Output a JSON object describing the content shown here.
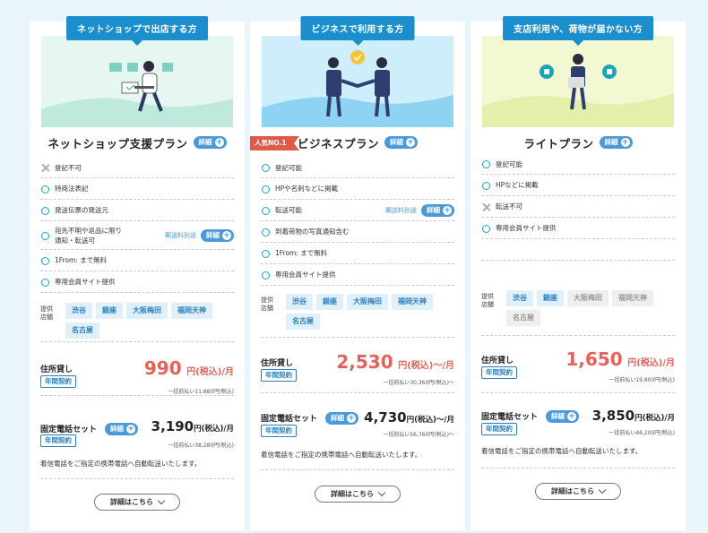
{
  "colors": {
    "accent": "#1b8fce",
    "price": "#e8605a",
    "check": "#1aa6b7",
    "page_bg": "#eaf4fb"
  },
  "cards": [
    {
      "tab": "ネットショップで出店する方",
      "title": "ネットショップ支援プラン",
      "detail_label": "詳細",
      "features": [
        {
          "ok": false,
          "text": "登記不可"
        },
        {
          "ok": true,
          "text": "特商法表記"
        },
        {
          "ok": true,
          "text": "発送伝票の発送元"
        },
        {
          "ok": true,
          "text": "宛先不明や返品に限り\n通知・転送可",
          "note": "郵送料別途",
          "detail": "詳細"
        },
        {
          "ok": true,
          "text": "1From: まで無料"
        },
        {
          "ok": true,
          "text": "専用会員サイト提供"
        }
      ],
      "stores_label": "提供\n店舗",
      "stores": [
        {
          "name": "渋谷",
          "available": true
        },
        {
          "name": "銀座",
          "available": true
        },
        {
          "name": "大阪梅田",
          "available": true
        },
        {
          "name": "福岡天神",
          "available": true
        },
        {
          "name": "名古屋",
          "available": true
        }
      ],
      "address_label": "住所貸し",
      "contract": "年間契約",
      "price": "990",
      "price_unit": "円(税込)/月",
      "lump_sum": "一括前払い11,880円(税込)",
      "tel_label": "固定電話セット",
      "tel_detail": "詳細",
      "tel_contract": "年間契約",
      "tel_price": "3,190",
      "tel_unit": "円(税込)/月",
      "tel_lump_sum": "一括前払い38,280円(税込)",
      "forward_note": "着信電話をご指定の携帯電話へ自動転送いたします。",
      "more": "詳細はこちら"
    },
    {
      "tab": "ビジネスで利用する方",
      "ribbon": "人気NO.1",
      "title": "ビジネスプラン",
      "detail_label": "詳細",
      "features": [
        {
          "ok": true,
          "text": "登記可能"
        },
        {
          "ok": true,
          "text": "HPや名刺などに掲載"
        },
        {
          "ok": true,
          "text": "転送可能",
          "note": "郵送料別途",
          "detail": "詳細"
        },
        {
          "ok": true,
          "text": "到着荷物の写真通知含む"
        },
        {
          "ok": true,
          "text": "1From: まで無料"
        },
        {
          "ok": true,
          "text": "専用会員サイト提供"
        }
      ],
      "stores_label": "提供\n店舗",
      "stores": [
        {
          "name": "渋谷",
          "available": true
        },
        {
          "name": "銀座",
          "available": true
        },
        {
          "name": "大阪梅田",
          "available": true
        },
        {
          "name": "福岡天神",
          "available": true
        },
        {
          "name": "名古屋",
          "available": true
        }
      ],
      "address_label": "住所貸し",
      "contract": "年間契約",
      "price": "2,530",
      "price_unit": "円(税込)～/月",
      "lump_sum": "一括前払い30,360円(税込)～",
      "tel_label": "固定電話セット",
      "tel_detail": "詳細",
      "tel_contract": "年間契約",
      "tel_price": "4,730",
      "tel_unit": "円(税込)～/月",
      "tel_lump_sum": "一括前払い56,760円(税込)～",
      "forward_note": "着信電話をご指定の携帯電話へ自動転送いたします。",
      "more": "詳細はこちら"
    },
    {
      "tab": "支店利用や、荷物が届かない方",
      "title": "ライトプラン",
      "detail_label": "詳細",
      "features": [
        {
          "ok": true,
          "text": "登記可能"
        },
        {
          "ok": true,
          "text": "HPなどに掲載"
        },
        {
          "ok": false,
          "text": "転送不可"
        },
        {
          "ok": true,
          "text": "専用会員サイト提供"
        }
      ],
      "stores_label": "提供\n店舗",
      "stores": [
        {
          "name": "渋谷",
          "available": true
        },
        {
          "name": "銀座",
          "available": true
        },
        {
          "name": "大阪梅田",
          "available": false
        },
        {
          "name": "福岡天神",
          "available": false
        },
        {
          "name": "名古屋",
          "available": false
        }
      ],
      "address_label": "住所貸し",
      "contract": "年間契約",
      "price": "1,650",
      "price_unit": "円(税込)/月",
      "lump_sum": "一括前払い19,800円(税込)",
      "tel_label": "固定電話セット",
      "tel_detail": "詳細",
      "tel_contract": "年間契約",
      "tel_price": "3,850",
      "tel_unit": "円(税込)/月",
      "tel_lump_sum": "一括前払い46,200円(税込)",
      "forward_note": "着信電話をご指定の携帯電話へ自動転送いたします。",
      "more": "詳細はこちら"
    }
  ]
}
